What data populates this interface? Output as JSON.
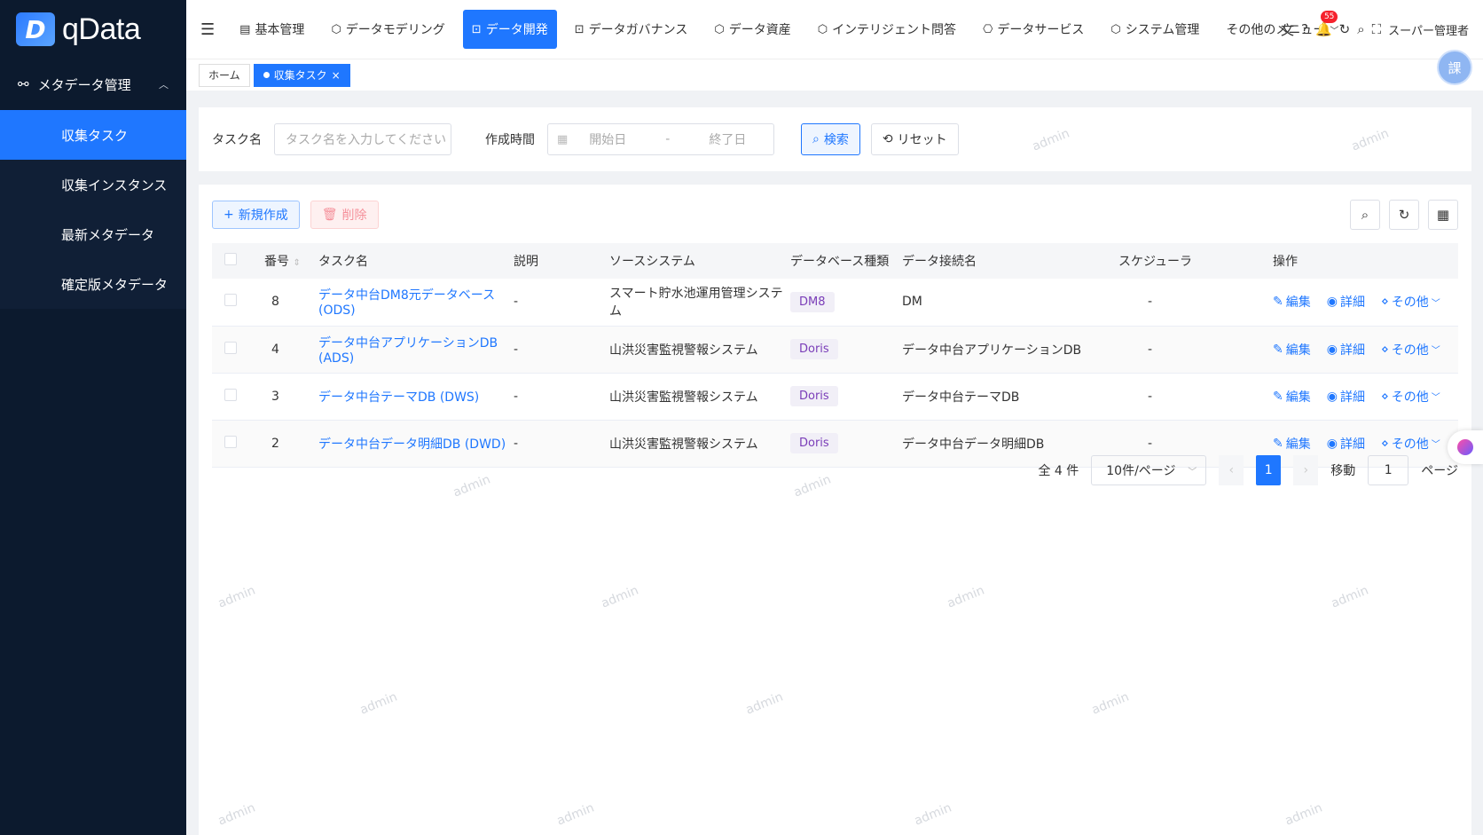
{
  "app": {
    "logo_mark": "D",
    "logo_text": "qData"
  },
  "sidebar": {
    "group_label": "メタデータ管理",
    "items": [
      {
        "label": "収集タスク",
        "active": true
      },
      {
        "label": "収集インスタンス",
        "active": false
      },
      {
        "label": "最新メタデータ",
        "active": false
      },
      {
        "label": "確定版メタデータ",
        "active": false
      }
    ]
  },
  "topnav": {
    "items": [
      {
        "label": "基本管理"
      },
      {
        "label": "データモデリング"
      },
      {
        "label": "データ開発",
        "active": true
      },
      {
        "label": "データガバナンス"
      },
      {
        "label": "データ資産"
      },
      {
        "label": "インテリジェント問答"
      },
      {
        "label": "データサービス"
      },
      {
        "label": "システム管理"
      },
      {
        "label": "その他のメニュー"
      }
    ],
    "notification_count": "55",
    "user_label": "スーパー管理者"
  },
  "tabs": [
    {
      "label": "ホーム"
    },
    {
      "label": "収集タスク",
      "active": true
    }
  ],
  "assistant_label": "課",
  "filter": {
    "task_name_label": "タスク名",
    "task_name_placeholder": "タスク名を入力してください",
    "created_label": "作成時間",
    "start_placeholder": "開始日",
    "date_sep": "-",
    "end_placeholder": "終了日",
    "search_label": "検索",
    "reset_label": "リセット"
  },
  "toolbar": {
    "create_label": "新規作成",
    "delete_label": "削除"
  },
  "table": {
    "headers": [
      "番号",
      "タスク名",
      "説明",
      "ソースシステム",
      "データベース種類",
      "データ接続名",
      "スケジューラ",
      "操作"
    ],
    "rows": [
      {
        "id": "8",
        "name": "データ中台DM8元データベース (ODS)",
        "desc": "-",
        "source": "スマート貯水池運用管理システム",
        "dbtype": "DM8",
        "conn": "DM",
        "sched": "-"
      },
      {
        "id": "4",
        "name": "データ中台アプリケーションDB (ADS)",
        "desc": "-",
        "source": "山洪災害監視警報システム",
        "dbtype": "Doris",
        "conn": "データ中台アプリケーションDB",
        "sched": "-"
      },
      {
        "id": "3",
        "name": "データ中台テーマDB (DWS)",
        "desc": "-",
        "source": "山洪災害監視警報システム",
        "dbtype": "Doris",
        "conn": "データ中台テーマDB",
        "sched": "-"
      },
      {
        "id": "2",
        "name": "データ中台データ明細DB (DWD)",
        "desc": "-",
        "source": "山洪災害監視警報システム",
        "dbtype": "Doris",
        "conn": "データ中台データ明細DB",
        "sched": "-"
      }
    ],
    "op_edit": "編集",
    "op_detail": "詳細",
    "op_more": "その他"
  },
  "pager": {
    "total": "全 4 件",
    "page_size": "10件/ページ",
    "current": "1",
    "goto_label": "移動",
    "goto_value": "1",
    "page_suffix": "ページ"
  },
  "watermark": "admin"
}
